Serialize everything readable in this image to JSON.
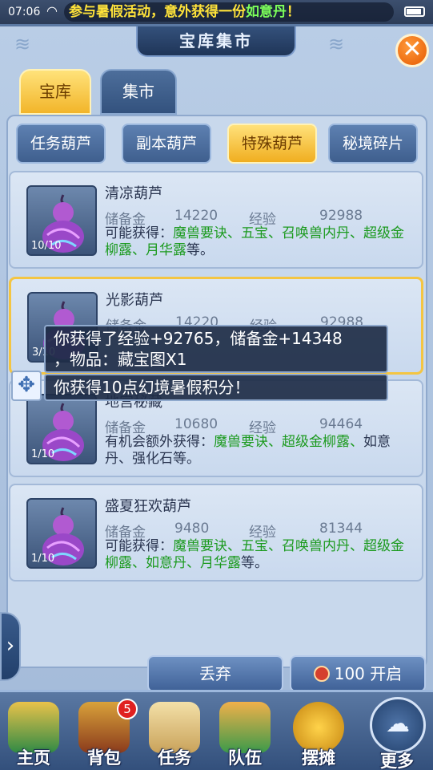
{
  "statusbar": {
    "time": "07:06",
    "marquee_a": "参与暑假活动，意外获得一份",
    "marquee_b": "如意丹",
    "marquee_c": "！"
  },
  "window": {
    "title": "宝库集市",
    "close": "✕"
  },
  "main_tabs": [
    {
      "label": "宝库",
      "active": true
    },
    {
      "label": "集市",
      "active": false
    }
  ],
  "sub_tabs": [
    {
      "label": "任务葫芦",
      "active": false
    },
    {
      "label": "副本葫芦",
      "active": false
    },
    {
      "label": "特殊葫芦",
      "active": true
    },
    {
      "label": "秘境碎片",
      "active": false
    }
  ],
  "stat_labels": {
    "money": "储备金",
    "exp": "经验"
  },
  "items": [
    {
      "name": "清凉葫芦",
      "money": "14220",
      "exp": "92988",
      "count": "10/10",
      "desc_prefix": "可能获得：",
      "desc_green": "魔兽要诀、五宝、召唤兽内丹、超级金柳露、月华露",
      "desc_suffix": "等。"
    },
    {
      "name": "光影葫芦",
      "money": "14220",
      "exp": "92988",
      "count": "3/10"
    },
    {
      "name": "地宫秘藏",
      "money": "10680",
      "exp": "94464",
      "count": "1/10",
      "desc_prefix": "有机会额外获得：",
      "desc_green": "魔兽要诀、超级金柳露、",
      "desc_plain": "如意丹、强化石等。"
    },
    {
      "name": "盛夏狂欢葫芦",
      "money": "9480",
      "exp": "81344",
      "count": "1/10",
      "desc_prefix": "可能获得：",
      "desc_green": "魔兽要诀、五宝、召唤兽内丹、超级金柳露、如意丹、月华露",
      "desc_suffix": "等。"
    }
  ],
  "toasts": {
    "reward_line1": "你获得了经验+92765，储备金+14348",
    "reward_line2": "，物品：藏宝图X1",
    "points": "你获得10点幻境暑假积分！"
  },
  "buttons": {
    "discard": "丢弃",
    "open_cost": "100",
    "open": "开启"
  },
  "bottom_nav": [
    {
      "label": "主页"
    },
    {
      "label": "背包",
      "badge": "5"
    },
    {
      "label": "任务"
    },
    {
      "label": "队伍"
    },
    {
      "label": "摆摊"
    },
    {
      "label": "更多"
    }
  ]
}
